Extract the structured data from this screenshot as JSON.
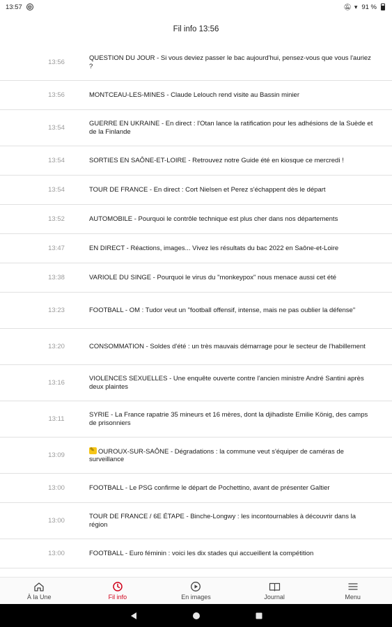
{
  "status_bar": {
    "time": "13:57",
    "battery": "91 %"
  },
  "header": {
    "title": "Fil info 13:56"
  },
  "feed": [
    {
      "time": "13:56",
      "text": "QUESTION DU JOUR - Si vous deviez passer le bac aujourd'hui, pensez-vous que vous l'auriez ?"
    },
    {
      "time": "13:56",
      "text": "MONTCEAU-LES-MINES - Claude Lelouch rend visite au Bassin minier"
    },
    {
      "time": "13:54",
      "text": "GUERRE EN UKRAINE - En direct : l'Otan lance la ratification pour les adhésions de la Suède et de la Finlande"
    },
    {
      "time": "13:54",
      "text": "SORTIES EN SAÔNE-ET-LOIRE - Retrouvez notre Guide été en kiosque ce mercredi !"
    },
    {
      "time": "13:54",
      "text": "TOUR DE FRANCE - En direct : Cort Nielsen et Perez s'échappent dès le départ"
    },
    {
      "time": "13:52",
      "text": "AUTOMOBILE - Pourquoi le contrôle technique est plus cher dans nos départements"
    },
    {
      "time": "13:47",
      "text": "EN DIRECT - Réactions, images... Vivez les résultats du bac 2022 en Saône-et-Loire"
    },
    {
      "time": "13:38",
      "text": "VARIOLE DU SINGE - Pourquoi le virus du \"monkeypox\" nous menace aussi cet été"
    },
    {
      "time": "13:23",
      "text": "FOOTBALL - OM : Tudor veut un \"football offensif, intense, mais ne pas oublier la défense\""
    },
    {
      "time": "13:20",
      "text": "CONSOMMATION - Soldes d'été : un très mauvais démarrage pour le secteur de l'habillement"
    },
    {
      "time": "13:16",
      "text": "VIOLENCES SEXUELLES - Une enquête ouverte contre l'ancien ministre André Santini après deux plaintes"
    },
    {
      "time": "13:11",
      "text": "SYRIE - La France rapatrie 35 mineurs et 16 mères, dont la djihadiste Emilie König, des camps de prisonniers"
    },
    {
      "time": "13:09",
      "text": "OUROUX-SUR-SAÔNE - Dégradations : la commune veut s'équiper de caméras de surveillance"
    },
    {
      "time": "13:00",
      "text": "FOOTBALL - Le PSG confirme le départ de Pochettino, avant de présenter Galtier"
    },
    {
      "time": "13:00",
      "text": "TOUR DE FRANCE / 6E ÉTAPE - Binche-Longwy : les incontournables à découvrir dans la région"
    },
    {
      "time": "13:00",
      "text": "FOOTBALL - Euro féminin : voici les dix stades qui accueillent la compétition"
    }
  ],
  "bottom_nav": [
    {
      "label": "À la Une",
      "icon": "home-icon"
    },
    {
      "label": "Fil info",
      "icon": "clock-icon"
    },
    {
      "label": "En images",
      "icon": "play-icon"
    },
    {
      "label": "Journal",
      "icon": "newspaper-icon"
    },
    {
      "label": "Menu",
      "icon": "menu-icon"
    }
  ],
  "colors": {
    "accent": "#d0021b",
    "timestamp": "#9a9a9a",
    "divider": "#e1e1e1",
    "badge": "#f5c518"
  }
}
